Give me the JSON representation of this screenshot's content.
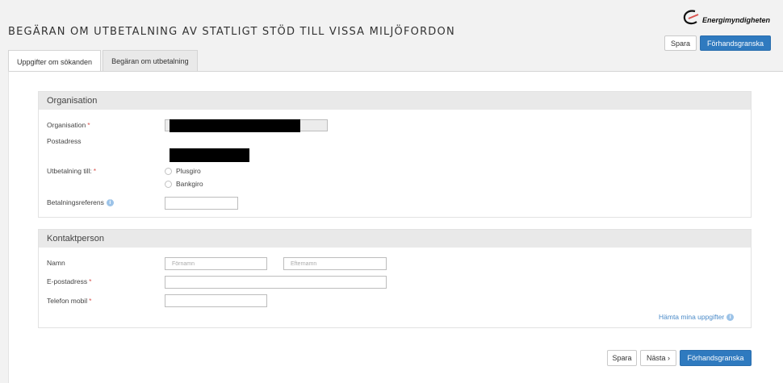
{
  "header": {
    "title": "BEGÄRAN OM UTBETALNING AV STATLIGT STÖD TILL VISSA MILJÖFORDON",
    "logo_text": "Energimyndigheten",
    "save_label": "Spara",
    "preview_label": "Förhandsgranska"
  },
  "tabs": [
    {
      "label": "Uppgifter om sökanden"
    },
    {
      "label": "Begäran om utbetalning"
    }
  ],
  "organisation": {
    "heading": "Organisation",
    "org_label": "Organisation",
    "address_label": "Postadress",
    "payment_label": "Utbetalning till:",
    "options": [
      "Plusgiro",
      "Bankgiro"
    ],
    "reference_label": "Betalningsreferens"
  },
  "contact": {
    "heading": "Kontaktperson",
    "name_label": "Namn",
    "firstname_placeholder": "Förnamn",
    "lastname_placeholder": "Efternamn",
    "email_label": "E-postadress",
    "phone_label": "Telefon mobil",
    "fetch_link": "Hämta mina uppgifter"
  },
  "footer": {
    "save_label": "Spara",
    "next_label": "Nästa ›",
    "preview_label": "Förhandsgranska"
  },
  "required_mark": "*",
  "colors": {
    "primary": "#2f7abf",
    "required": "#d9534f",
    "link": "#4a8ac8"
  }
}
